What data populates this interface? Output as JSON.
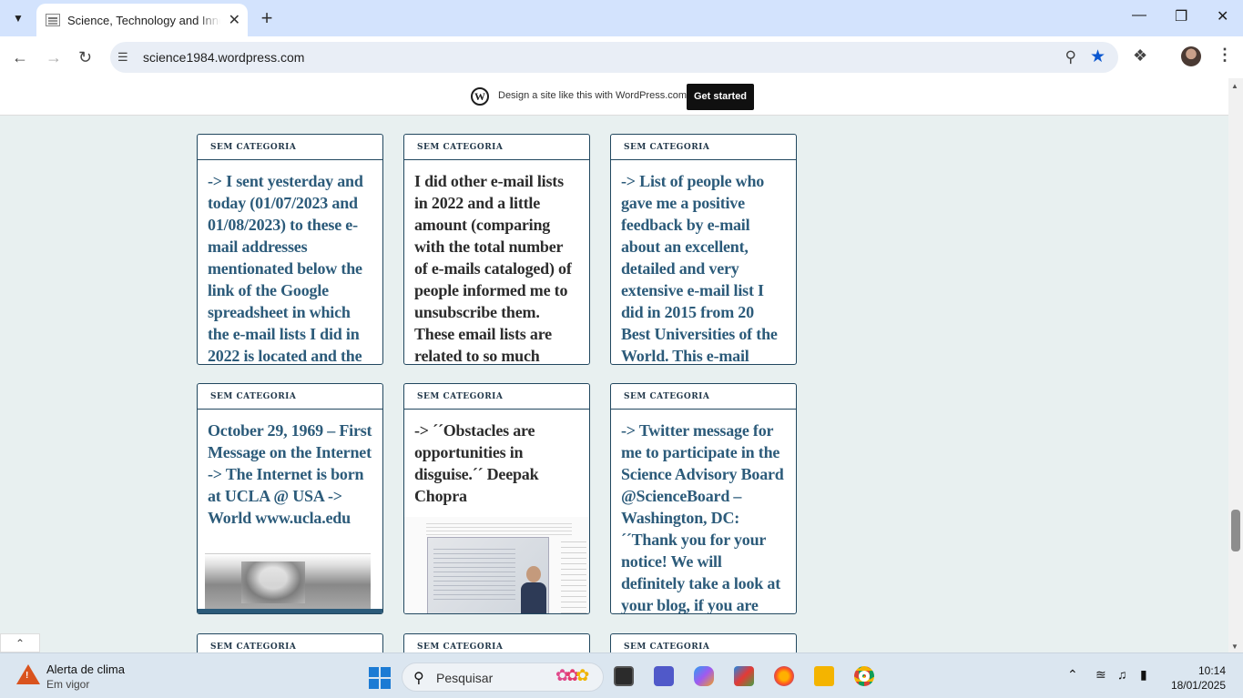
{
  "browser": {
    "tab_title": "Science, Technology and Innova",
    "url": "science1984.wordpress.com"
  },
  "wp_banner": {
    "text": "Design a site like this with WordPress.com",
    "button": "Get started"
  },
  "cards": [
    {
      "category": "SEM CATEGORIA",
      "title": "-> I sent yesterday and today (01/07/2023 and 01/08/2023) to these e-mail addresses mentionated below the link of the Google spreadsheet in which the e-mail lists I did in 2022 is located and the"
    },
    {
      "category": "SEM CATEGORIA",
      "title": "I did other e-mail lists in 2022 and a little amount (comparing with the total number of e-mails cataloged) of people informed me to unsubscribe them. These email lists are related to so much"
    },
    {
      "category": "SEM CATEGORIA",
      "title": "-> List of people who gave me a positive feedback by e-mail about an excellent, detailed and very extensive e-mail list I did in 2015 from 20 Best Universities of the World. This e-mail"
    },
    {
      "category": "SEM CATEGORIA",
      "title": "October 29, 1969 – First Message on the Internet -> The Internet is born at UCLA @ USA -> World www.ucla.edu"
    },
    {
      "category": "SEM CATEGORIA",
      "title": "-> ´´Obstacles are opportunities in disguise.´´ Deepak Chopra"
    },
    {
      "category": "SEM CATEGORIA",
      "title": "-> Twitter message for me to participate in the Science Advisory Board @ScienceBoard – Washington, DC: ´´Thank you for your notice! We will definitely take a look at your blog, if you are"
    },
    {
      "category": "SEM CATEGORIA"
    },
    {
      "category": "SEM CATEGORIA"
    },
    {
      "category": "SEM CATEGORIA"
    }
  ],
  "taskbar": {
    "weather_title": "Alerta de clima",
    "weather_sub": "Em vigor",
    "search_placeholder": "Pesquisar",
    "time": "10:14",
    "date": "18/01/2025"
  }
}
